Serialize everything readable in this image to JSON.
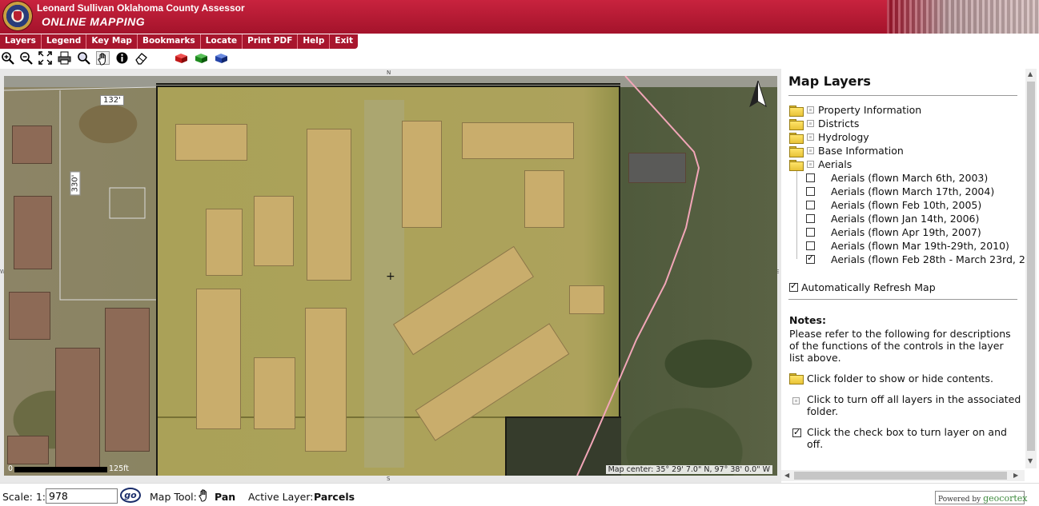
{
  "header": {
    "org": "Leonard Sullivan Oklahoma County Assessor",
    "app": "ONLINE MAPPING"
  },
  "menu": [
    "Layers",
    "Legend",
    "Key Map",
    "Bookmarks",
    "Locate",
    "Print PDF",
    "Help",
    "Exit"
  ],
  "toolbar": {
    "tools": [
      "zoom-in-icon",
      "zoom-out-icon",
      "full-extent-icon",
      "print-icon",
      "magnify-icon",
      "pan-hand-icon",
      "info-icon",
      "eraser-icon",
      "red-box-icon",
      "green-box-icon",
      "blue-box-icon"
    ]
  },
  "map": {
    "dim_top": "132'",
    "dim_left": "330'",
    "scale_zero": "0",
    "scale_label": "125ft",
    "center": "Map center: 35° 29' 7.0\" N, 97° 38' 0.0\" W",
    "north": "N",
    "south": "S",
    "east": "E",
    "west": "W"
  },
  "panel": {
    "title": "Map Layers",
    "folders": [
      "Property Information",
      "Districts",
      "Hydrology",
      "Base Information",
      "Aerials"
    ],
    "aerials": [
      {
        "label": "Aerials (flown March 6th, 2003)",
        "checked": false
      },
      {
        "label": "Aerials (flown March 17th, 2004)",
        "checked": false
      },
      {
        "label": "Aerials (flown Feb 10th, 2005)",
        "checked": false
      },
      {
        "label": "Aerials (flown Jan 14th, 2006)",
        "checked": false
      },
      {
        "label": "Aerials (flown Apr 19th, 2007)",
        "checked": false
      },
      {
        "label": "Aerials (flown Mar 19th-29th, 2010)",
        "checked": false
      },
      {
        "label": "Aerials (flown Feb 28th - March 23rd, 20",
        "checked": true
      }
    ],
    "auto_refresh": "Automatically Refresh Map",
    "notes_title": "Notes:",
    "notes_body": "Please refer to the following for descriptions of the functions of the controls in the layer list above.",
    "note_folder": "Click folder to show or hide contents.",
    "note_square": "Click to turn off all layers in the associated folder.",
    "note_check": "Click the check box to turn layer on and off."
  },
  "status": {
    "scale_label": "Scale: 1:",
    "scale_value": "978",
    "go": "go",
    "map_tool_label": "Map Tool:",
    "map_tool_value": "Pan",
    "active_layer_label": "Active Layer:",
    "active_layer_value": "Parcels",
    "powered_prefix": "Powered by",
    "powered_brand": "geocortex"
  }
}
